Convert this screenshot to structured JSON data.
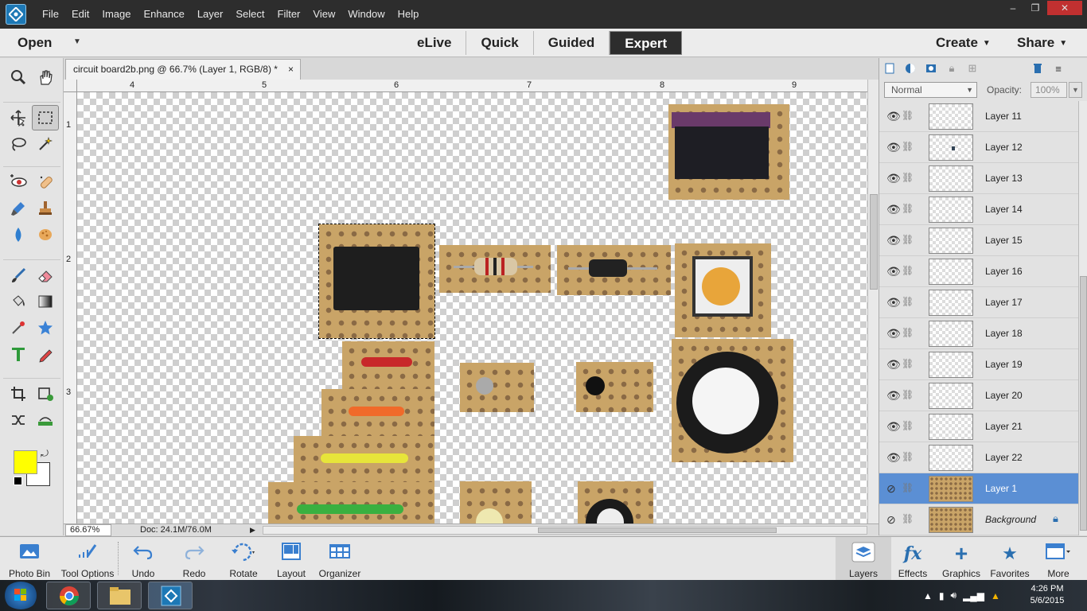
{
  "menubar": {
    "items": [
      "File",
      "Edit",
      "Image",
      "Enhance",
      "Layer",
      "Select",
      "Filter",
      "View",
      "Window",
      "Help"
    ],
    "window_controls": [
      "–",
      "❐",
      "✕"
    ]
  },
  "modebar": {
    "open_label": "Open",
    "modes": [
      "eLive",
      "Quick",
      "Guided",
      "Expert"
    ],
    "active_mode": "Expert",
    "create_label": "Create",
    "share_label": "Share"
  },
  "document": {
    "tab_title": "circuit board2b.png @ 66.7% (Layer 1, RGB/8) *",
    "close_glyph": "×",
    "ruler_top": [
      "4",
      "5",
      "6",
      "7",
      "8",
      "9"
    ],
    "ruler_left": [
      "1",
      "2",
      "3"
    ]
  },
  "statusbar": {
    "zoom": "66.67%",
    "doc_info": "Doc: 24.1M/76.0M",
    "arrow": "▶"
  },
  "colors": {
    "foreground": "#ffff00",
    "background": "#ffffff",
    "accent": "#5b8fd4"
  },
  "layers_panel": {
    "blend_mode": "Normal",
    "opacity_label": "Opacity:",
    "opacity_value": "100%",
    "layers": [
      {
        "name": "Layer 11",
        "visible": true
      },
      {
        "name": "Layer 12",
        "visible": true
      },
      {
        "name": "Layer 13",
        "visible": true
      },
      {
        "name": "Layer 14",
        "visible": true
      },
      {
        "name": "Layer 15",
        "visible": true
      },
      {
        "name": "Layer 16",
        "visible": true
      },
      {
        "name": "Layer 17",
        "visible": true
      },
      {
        "name": "Layer 18",
        "visible": true
      },
      {
        "name": "Layer 19",
        "visible": true
      },
      {
        "name": "Layer 20",
        "visible": true
      },
      {
        "name": "Layer 21",
        "visible": true
      },
      {
        "name": "Layer 22",
        "visible": true
      },
      {
        "name": "Layer 1",
        "visible": false,
        "selected": true
      },
      {
        "name": "Background",
        "visible": false,
        "locked": true
      }
    ]
  },
  "bottombar": {
    "items": [
      "Photo Bin",
      "Tool Options",
      "Undo",
      "Redo",
      "Rotate",
      "Layout",
      "Organizer"
    ],
    "right_items": [
      "Layers",
      "Effects",
      "Graphics",
      "Favorites",
      "More"
    ]
  },
  "taskbar": {
    "time": "4:26 PM",
    "date": "5/6/2015"
  }
}
